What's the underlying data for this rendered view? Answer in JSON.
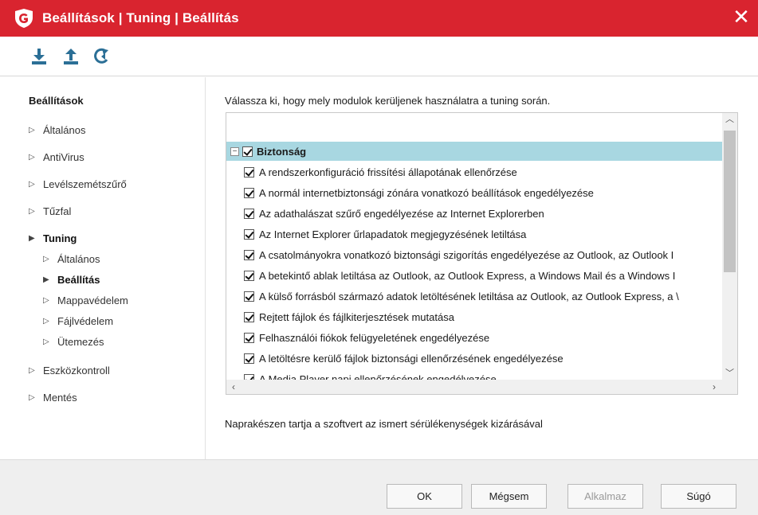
{
  "window": {
    "title": "Beállítások | Tuning | Beállítás",
    "accent": "#d9242f",
    "icons": {
      "logo": "gdata-shield-icon",
      "close": "close-icon"
    }
  },
  "toolbar": {
    "buttons": [
      {
        "name": "import-icon"
      },
      {
        "name": "export-icon"
      },
      {
        "name": "reset-icon"
      }
    ]
  },
  "sidebar": {
    "heading": "Beállítások",
    "items": [
      {
        "label": "Általános"
      },
      {
        "label": "AntiVirus"
      },
      {
        "label": "Levélszemétszűrő"
      },
      {
        "label": "Tűzfal"
      },
      {
        "label": "Tuning",
        "expanded": true
      },
      {
        "label": "Általános"
      },
      {
        "label": "Beállítás",
        "selected": true
      },
      {
        "label": "Mappavédelem"
      },
      {
        "label": "Fájlvédelem"
      },
      {
        "label": "Ütemezés"
      },
      {
        "label": "Eszközkontroll"
      },
      {
        "label": "Mentés"
      }
    ]
  },
  "main": {
    "intro": "Válassza ki, hogy mely modulok kerüljenek használatra a tuning során.",
    "group": {
      "label": "Biztonság",
      "checked": true,
      "expanded": true,
      "highlight": "#a8d7e1"
    },
    "items": [
      {
        "label": "A rendszerkonfiguráció frissítési állapotának ellenőrzése",
        "checked": true
      },
      {
        "label": "A normál internetbiztonsági zónára vonatkozó beállítások engedélyezése",
        "checked": true
      },
      {
        "label": "Az adathalászat szűrő engedélyezése az Internet Explorerben",
        "checked": true
      },
      {
        "label": "Az Internet Explorer űrlapadatok megjegyzésének letiltása",
        "checked": true
      },
      {
        "label": "A csatolmányokra vonatkozó biztonsági szigorítás engedélyezése az Outlook, az Outlook I",
        "checked": true
      },
      {
        "label": "A betekintő ablak letiltása az Outlook, az Outlook Express, a Windows Mail és a Windows I",
        "checked": true
      },
      {
        "label": "A külső forrásból származó adatok letöltésének letiltása az Outlook, az Outlook Express, a \\",
        "checked": true
      },
      {
        "label": "Rejtett fájlok és fájlkiterjesztések mutatása",
        "checked": true
      },
      {
        "label": "Felhasználói fiókok felügyeletének engedélyezése",
        "checked": true
      },
      {
        "label": "A letöltésre kerülő fájlok biztonsági ellenőrzésének engedélyezése",
        "checked": true
      },
      {
        "label": "A Media Player napi ellenőrzésének engedélyezése",
        "checked": true
      }
    ],
    "description": "Naprakészen tartja a szoftvert az ismert sérülékenységek kizárásával"
  },
  "footer": {
    "ok": "OK",
    "cancel": "Mégsem",
    "apply": "Alkalmaz",
    "help": "Súgó"
  }
}
